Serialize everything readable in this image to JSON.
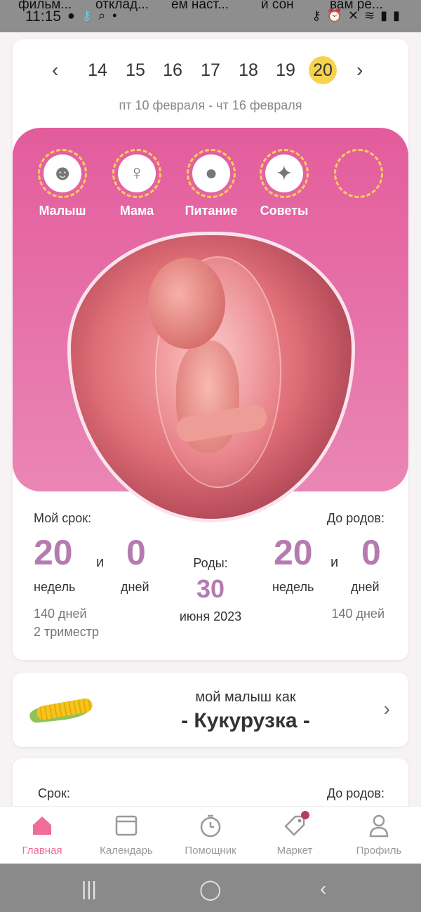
{
  "status_bar": {
    "notifications": [
      "фильм...",
      "отклад...",
      "ем наст...",
      "й сон",
      "вам ре..."
    ],
    "time": "11:15"
  },
  "week_selector": {
    "weeks": [
      "14",
      "15",
      "16",
      "17",
      "18",
      "19",
      "20"
    ],
    "active_week": "20",
    "date_range": "пт 10 февраля - чт 16 февраля"
  },
  "categories": [
    {
      "label": "Малыш",
      "icon": "baby-icon"
    },
    {
      "label": "Мама",
      "icon": "mother-icon"
    },
    {
      "label": "Питание",
      "icon": "apple-icon"
    },
    {
      "label": "Советы",
      "icon": "tips-icon"
    },
    {
      "label": "",
      "icon": "empty-slot"
    }
  ],
  "stats": {
    "my_term_label": "Мой срок:",
    "until_birth_label": "До родов:",
    "term_weeks": "20",
    "term_days": "0",
    "and": "и",
    "weeks_unit": "недель",
    "days_unit": "дней",
    "term_total_days": "140 дней",
    "trimester": "2 триместр",
    "births_label": "Роды:",
    "births_day": "30",
    "births_month_year": "июня 2023",
    "left_weeks": "20",
    "left_days": "0",
    "left_total_days": "140 дней"
  },
  "baby_like": {
    "label": "мой малыш как",
    "name": "- Кукурузка -"
  },
  "third_card": {
    "left_label": "Срок:",
    "right_label": "До родов:"
  },
  "bottom_nav": [
    {
      "label": "Главная",
      "active": true
    },
    {
      "label": "Календарь",
      "active": false
    },
    {
      "label": "Помощник",
      "active": false
    },
    {
      "label": "Маркет",
      "active": false
    },
    {
      "label": "Профиль",
      "active": false
    }
  ],
  "colors": {
    "accent_pink": "#ef6d96",
    "stat_purple": "#b57bb1",
    "active_week_yellow": "#f6d34f"
  }
}
